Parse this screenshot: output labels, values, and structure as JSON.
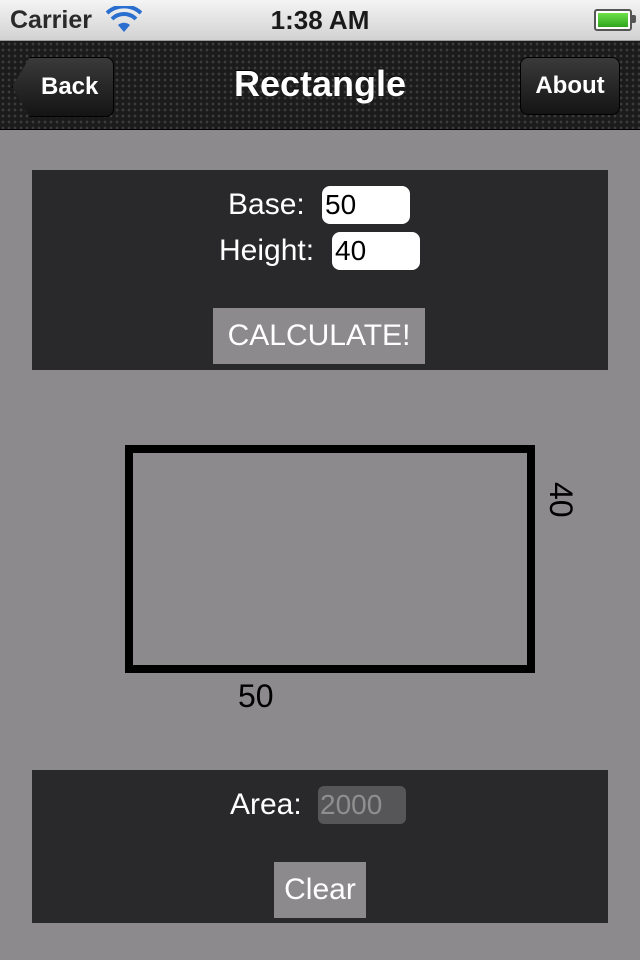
{
  "status_bar": {
    "carrier": "Carrier",
    "time": "1:38 AM",
    "wifi_icon": "wifi-icon",
    "battery_icon": "battery-icon"
  },
  "nav": {
    "title": "Rectangle",
    "back_label": "Back",
    "about_label": "About"
  },
  "form": {
    "base_label": "Base:",
    "base_value": "50",
    "height_label": "Height:",
    "height_value": "40",
    "calculate_label": "CALCULATE!"
  },
  "diagram": {
    "base_text": "50",
    "height_text": "40"
  },
  "result": {
    "area_label": "Area:",
    "area_value": "2000",
    "clear_label": "Clear"
  },
  "colors": {
    "background": "#8c8a8c",
    "panel": "#29282b",
    "button": "#8c8a8c"
  }
}
